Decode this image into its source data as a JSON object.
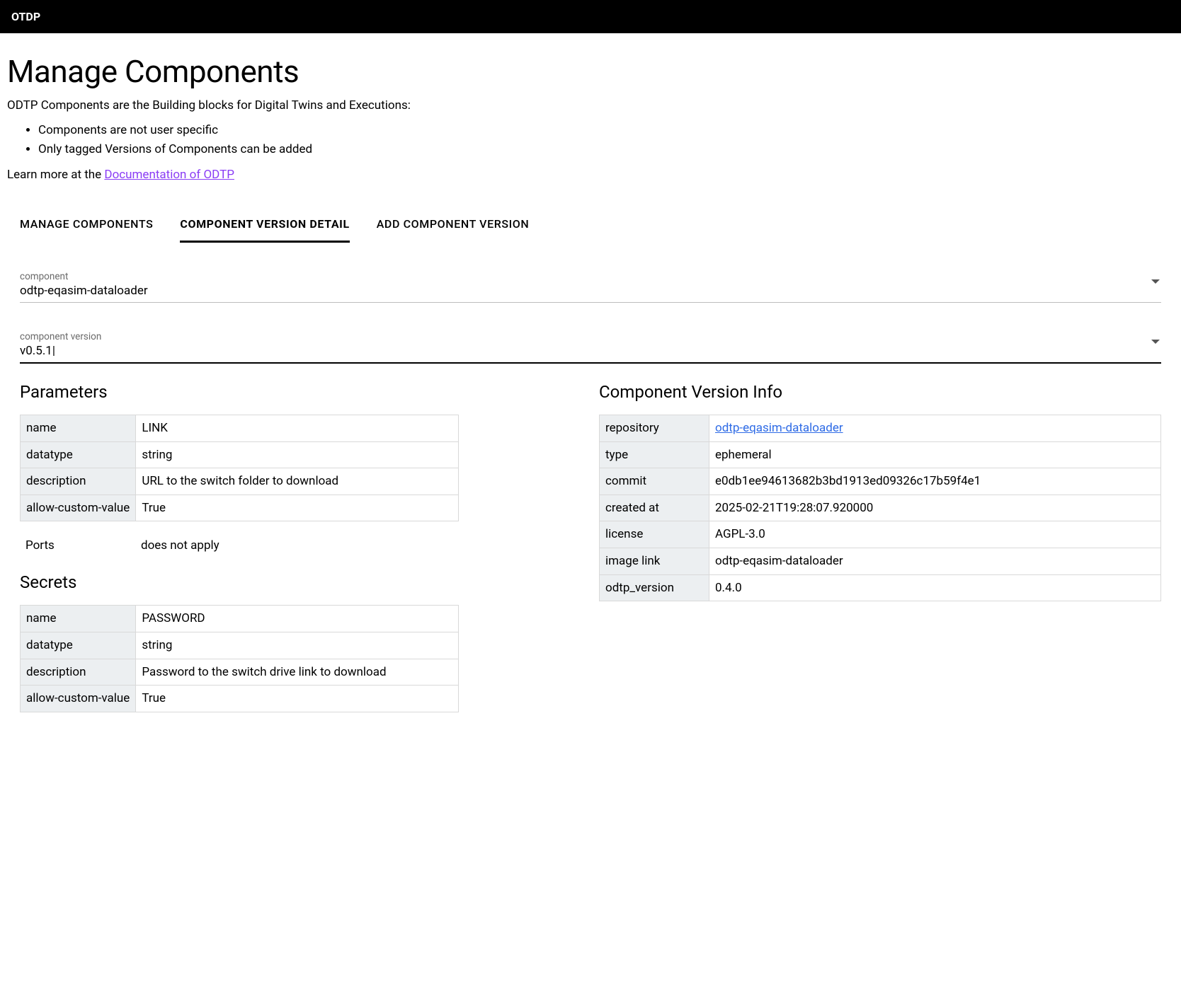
{
  "topbar": {
    "title": "OTDP"
  },
  "page": {
    "heading": "Manage Components",
    "intro": "ODTP Components are the Building blocks for Digital Twins and Executions:",
    "bullets": [
      "Components are not user specific",
      "Only tagged Versions of Components can be added"
    ],
    "learn_prefix": "Learn more at the ",
    "learn_link_text": "Documentation of ODTP"
  },
  "tabs": {
    "items": [
      {
        "label": "MANAGE COMPONENTS",
        "active": false
      },
      {
        "label": "COMPONENT VERSION DETAIL",
        "active": true
      },
      {
        "label": "ADD COMPONENT VERSION",
        "active": false
      }
    ]
  },
  "selects": {
    "component": {
      "label": "component",
      "value": "odtp-eqasim-dataloader"
    },
    "version": {
      "label": "component version",
      "value": "v0.5.1"
    }
  },
  "parameters": {
    "heading": "Parameters",
    "rows": [
      {
        "k": "name",
        "v": "LINK"
      },
      {
        "k": "datatype",
        "v": "string"
      },
      {
        "k": "description",
        "v": "URL to the switch folder to download"
      },
      {
        "k": "allow-custom-value",
        "v": "True"
      }
    ],
    "ports_label": "Ports",
    "ports_value": "does not apply"
  },
  "secrets": {
    "heading": "Secrets",
    "rows": [
      {
        "k": "name",
        "v": "PASSWORD"
      },
      {
        "k": "datatype",
        "v": "string"
      },
      {
        "k": "description",
        "v": "Password to the switch drive link to download"
      },
      {
        "k": "allow-custom-value",
        "v": "True"
      }
    ]
  },
  "info": {
    "heading": "Component Version Info",
    "repo_label": "repository",
    "repo_link_text": "odtp-eqasim-dataloader",
    "rows": [
      {
        "k": "type",
        "v": "ephemeral"
      },
      {
        "k": "commit",
        "v": "e0db1ee94613682b3bd1913ed09326c17b59f4e1"
      },
      {
        "k": "created at",
        "v": "2025-02-21T19:28:07.920000"
      },
      {
        "k": "license",
        "v": "AGPL-3.0"
      },
      {
        "k": "image link",
        "v": "odtp-eqasim-dataloader"
      },
      {
        "k": "odtp_version",
        "v": "0.4.0"
      }
    ]
  }
}
